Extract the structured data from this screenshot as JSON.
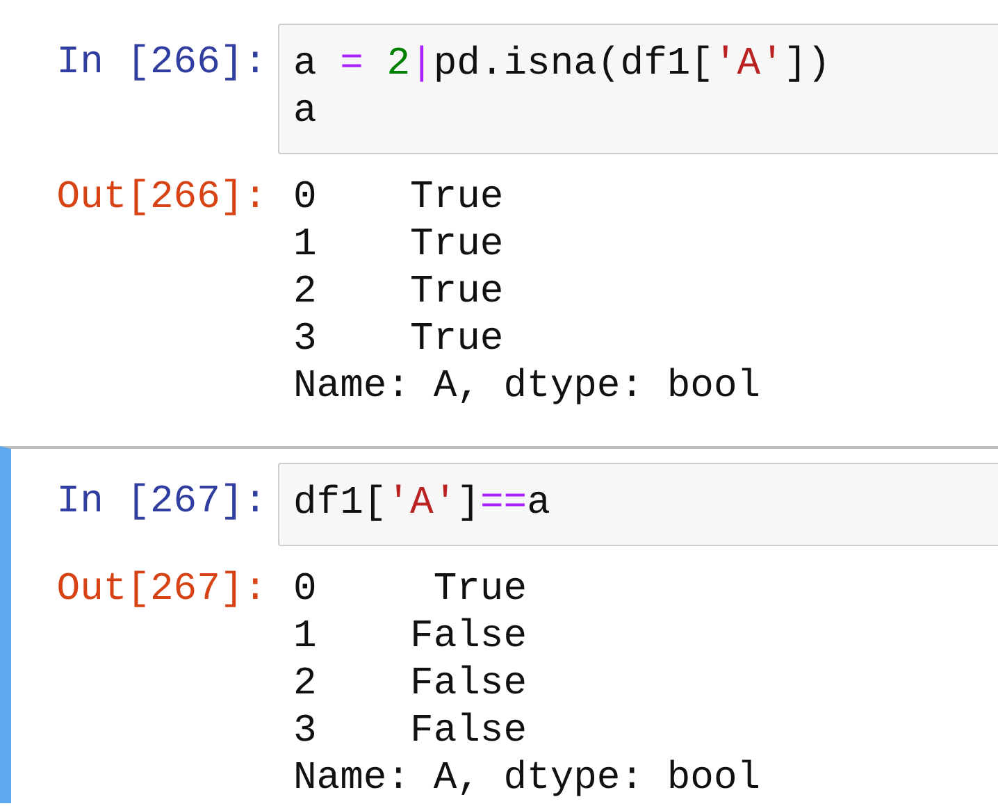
{
  "cells": [
    {
      "selected": false,
      "input_prompt": "In [266]:",
      "code_lines": [
        [
          {
            "kind": "plain",
            "text": "a "
          },
          {
            "kind": "operator",
            "text": "="
          },
          {
            "kind": "number",
            "text": " 2"
          },
          {
            "kind": "operator",
            "text": "|"
          },
          {
            "kind": "plain",
            "text": "pd.isna(df1["
          },
          {
            "kind": "string",
            "text": "'A'"
          },
          {
            "kind": "plain",
            "text": "])"
          }
        ],
        [
          {
            "kind": "plain",
            "text": "a"
          }
        ]
      ],
      "output_prompt": "Out[266]:",
      "output_lines": [
        "0    True",
        "1    True",
        "2    True",
        "3    True",
        "Name: A, dtype: bool"
      ]
    },
    {
      "selected": true,
      "input_prompt": "In [267]:",
      "code_lines": [
        [
          {
            "kind": "plain",
            "text": "df1["
          },
          {
            "kind": "string",
            "text": "'A'"
          },
          {
            "kind": "plain",
            "text": "]"
          },
          {
            "kind": "operator",
            "text": "=="
          },
          {
            "kind": "plain",
            "text": "a"
          }
        ]
      ],
      "output_prompt": "Out[267]:",
      "output_lines": [
        "0     True",
        "1    False",
        "2    False",
        "3    False",
        "Name: A, dtype: bool"
      ]
    }
  ]
}
